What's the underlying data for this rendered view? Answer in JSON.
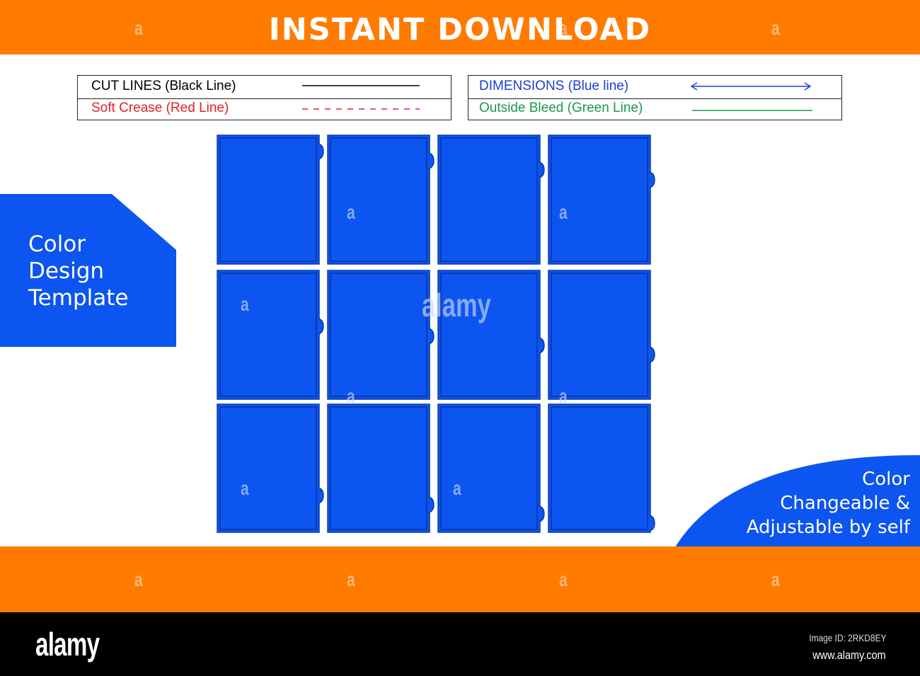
{
  "banner": {
    "title": "INSTANT DOWNLOAD",
    "background_color": "#ff7b00"
  },
  "legend": {
    "left": [
      {
        "label": "CUT LINES (Black Line)",
        "color": "#000000",
        "line_style": "solid"
      },
      {
        "label": "Soft Crease (Red Line)",
        "color": "#e0202a",
        "line_style": "dashed"
      }
    ],
    "right": [
      {
        "label": "DIMENSIONS (Blue line)",
        "color": "#1a3fd8",
        "line_style": "double-arrow"
      },
      {
        "label": "Outside Bleed (Green Line)",
        "color": "#1a9a48",
        "line_style": "solid"
      }
    ]
  },
  "side_badge": {
    "lines": [
      "Color",
      "Design",
      "Template"
    ],
    "color": "#0d55f0"
  },
  "corner_badge": {
    "lines": [
      "Color",
      "Changeable &",
      "Adjustable by self"
    ],
    "color": "#0d55f0"
  },
  "dieline": {
    "rows": 3,
    "columns": 4,
    "panel_fill": "#0d55f0",
    "panel_outline": "#0a3cb0",
    "panel_count": 12
  },
  "watermark": {
    "glyph": "a",
    "word": "alamy"
  },
  "footer": {
    "logo": "alamy",
    "image_id": "Image ID: 2RKD8EY",
    "url": "www.alamy.com"
  }
}
